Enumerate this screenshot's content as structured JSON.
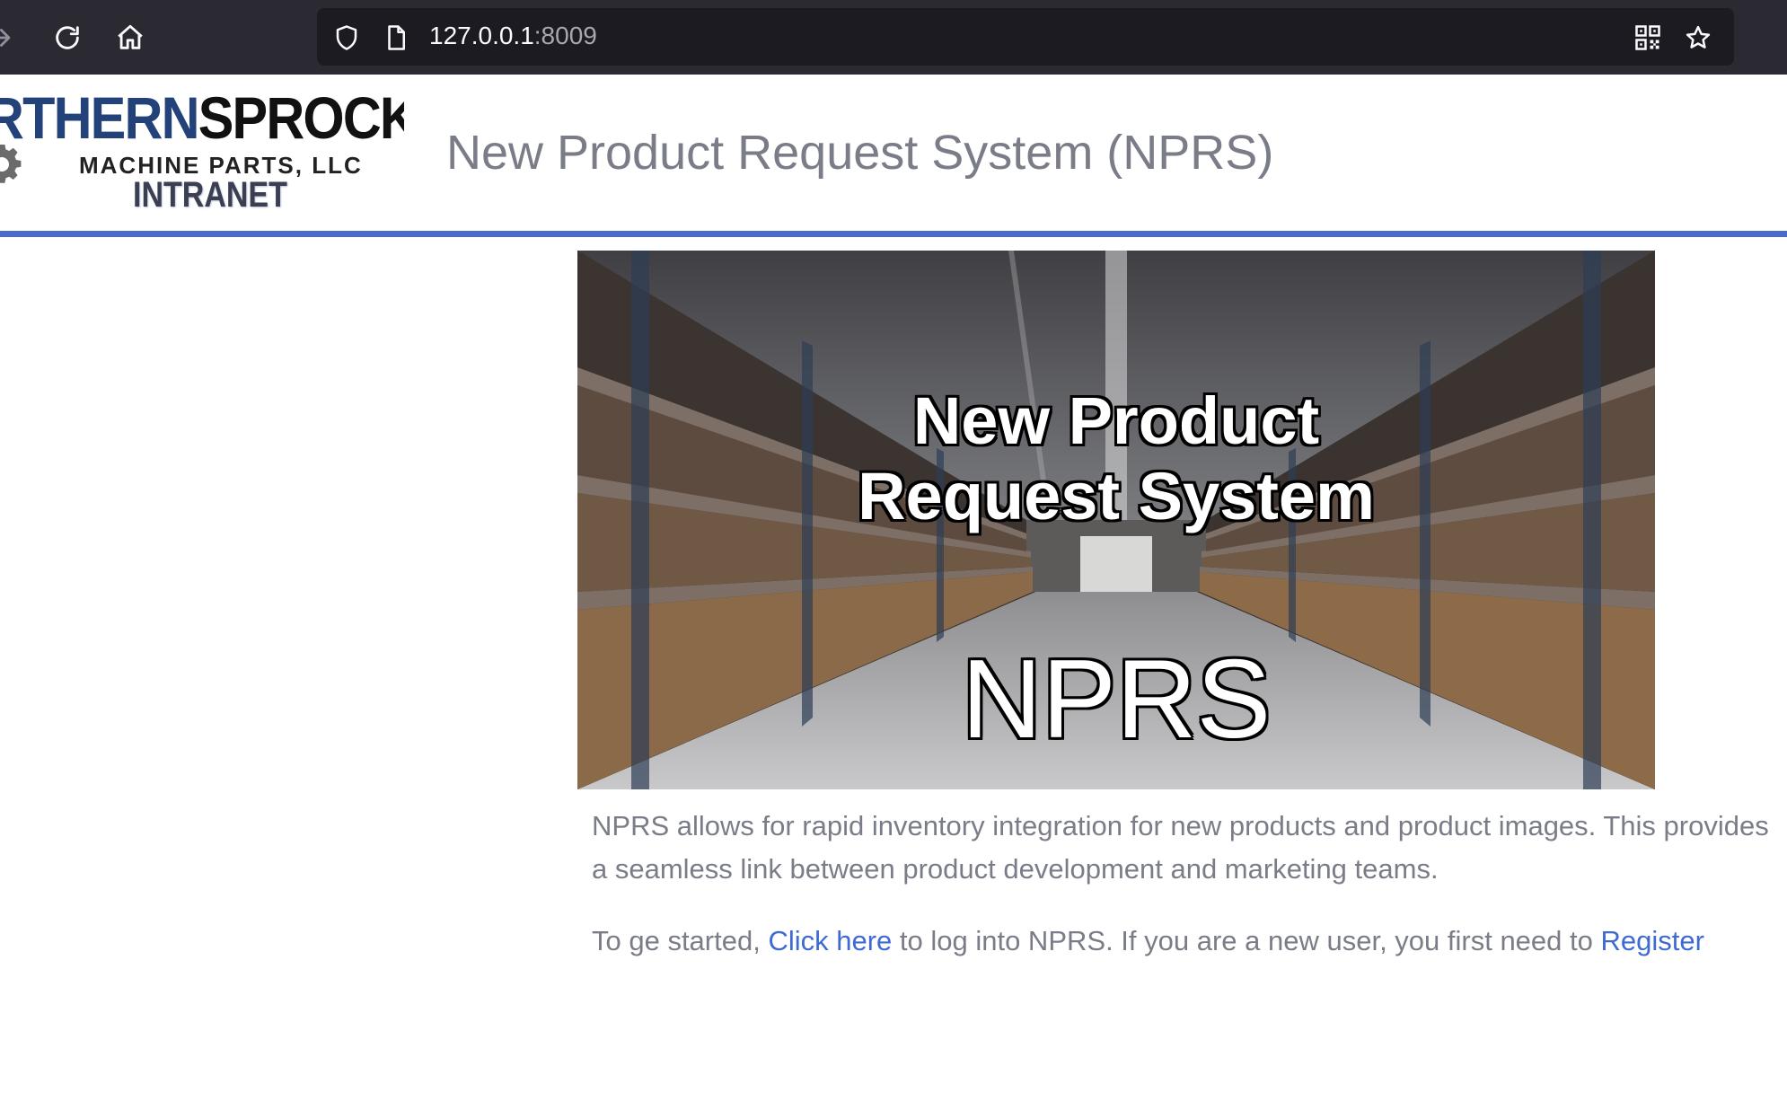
{
  "browser": {
    "url_host": "127.0.0.1",
    "url_port": ":8009",
    "icons": [
      "forward-icon",
      "reload-icon",
      "home-icon",
      "shield-icon",
      "page-icon",
      "qr-code-icon",
      "star-icon"
    ]
  },
  "header": {
    "logo": {
      "line1_part1": "RTHERN",
      "line1_part2": "SPROCKET",
      "line2": "MACHINE PARTS, LLC",
      "line3": "INTRANET"
    },
    "title": "New Product Request System (NPRS)",
    "rule_color": "#4a6bc8"
  },
  "hero": {
    "heading_line1": "New Product",
    "heading_line2": "Request System",
    "acronym": "NPRS"
  },
  "content": {
    "intro": "NPRS allows for rapid inventory integration for new products and product images. This provides a seamless link between product development and marketing teams.",
    "cta_prefix": "To ge started, ",
    "login_link": "Click here",
    "cta_middle": " to log into NPRS. If you are a new user, you first need to ",
    "register_link": "Register"
  },
  "colors": {
    "link": "#3f6ad2",
    "text": "#7a7d87",
    "toolbar": "#2b2a33",
    "urlbar": "#1c1b22"
  }
}
